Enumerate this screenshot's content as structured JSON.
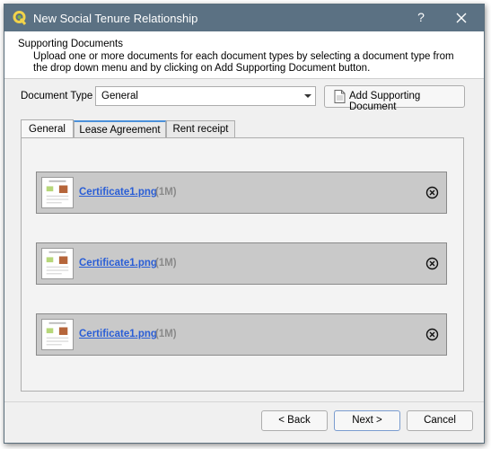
{
  "window": {
    "title": "New Social Tenure Relationship",
    "help_symbol": "?",
    "app_icon": "qgis-icon",
    "close_icon": "close-icon"
  },
  "header": {
    "title": "Supporting Documents",
    "subtitle": "Upload one or more documents for each document types by selecting a document type from the drop down menu and by clicking on Add Supporting Document button."
  },
  "document_type": {
    "label": "Document Type",
    "selected": "General"
  },
  "add_button": {
    "label": "Add Supporting Document",
    "icon": "document-icon"
  },
  "tabs": [
    {
      "label": "General",
      "active": true
    },
    {
      "label": "Lease Agreement",
      "active": false
    },
    {
      "label": "Rent receipt",
      "active": false
    }
  ],
  "documents": [
    {
      "name": "Certificate1.png",
      "size": "(1M)"
    },
    {
      "name": "Certificate1.png",
      "size": "(1M)"
    },
    {
      "name": "Certificate1.png",
      "size": "(1M)"
    }
  ],
  "footer": {
    "back_label": "< Back",
    "next_label": "Next >",
    "cancel_label": "Cancel"
  },
  "colors": {
    "titlebar": "#5b7183",
    "link": "#2a5ed6",
    "row_bg": "#c9c9c9"
  }
}
